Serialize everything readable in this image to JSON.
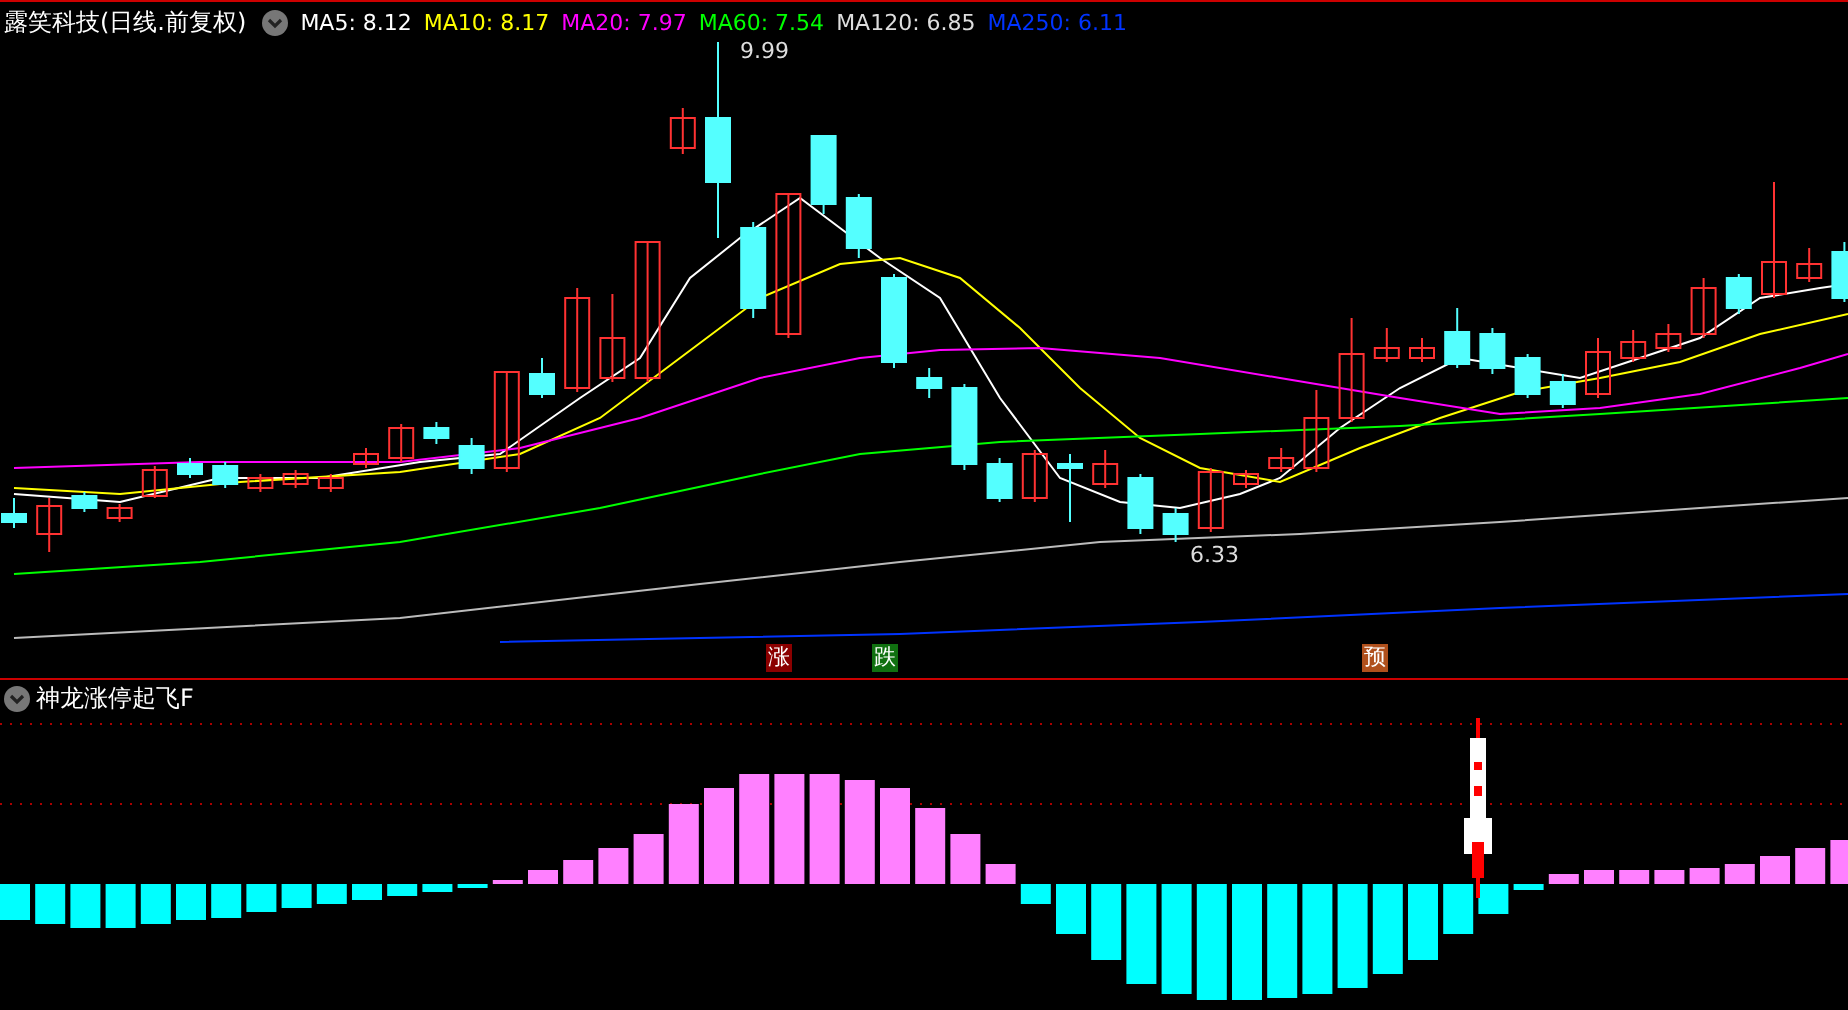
{
  "title": "露笑科技(日线.前复权)",
  "moving_averages": [
    {
      "label": "MA5: 8.12",
      "color": "#ffffff"
    },
    {
      "label": "MA10: 8.17",
      "color": "#ffff00"
    },
    {
      "label": "MA20: 7.97",
      "color": "#ff00ff"
    },
    {
      "label": "MA60: 7.54",
      "color": "#00ff00"
    },
    {
      "label": "MA120: 6.85",
      "color": "#dddddd"
    },
    {
      "label": "MA250: 6.11",
      "color": "#0033ff"
    }
  ],
  "price_labels": [
    {
      "text": "9.99",
      "kind": "high"
    },
    {
      "text": "6.33",
      "kind": "low"
    }
  ],
  "signals": [
    {
      "text": "涨",
      "kind": "rise"
    },
    {
      "text": "跌",
      "kind": "fall"
    },
    {
      "text": "预",
      "kind": "forecast"
    }
  ],
  "indicator": {
    "title": "神龙涨停起飞F"
  }
}
